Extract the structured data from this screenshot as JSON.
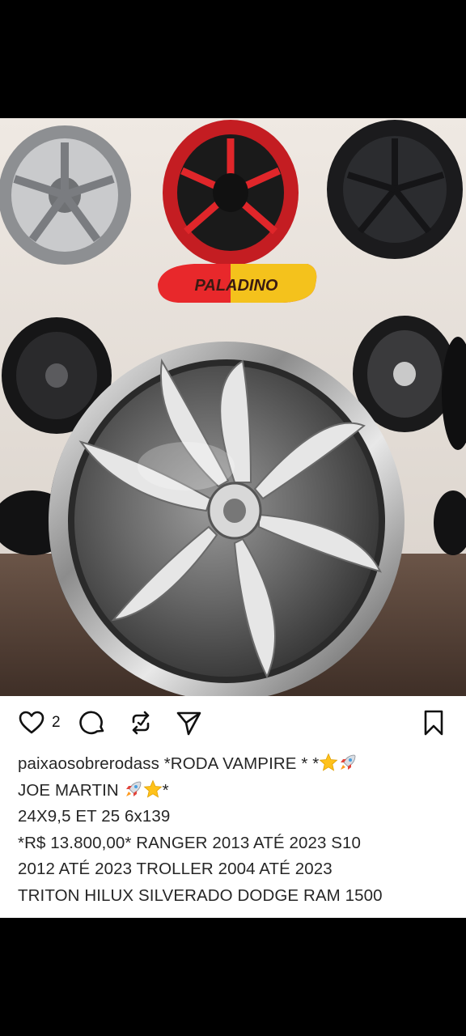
{
  "post": {
    "like_count": "2",
    "username": "paixaosobrerodass",
    "caption_lines": [
      "*RODA VAMPIRE * *",
      "JOE MARTIN ",
      "24X9,5 ET 25 6x139",
      "*R$ 13.800,00*  RANGER 2013 ATÉ 2023 S10",
      "2012 ATÉ 2023 TROLLER 2004 ATÉ 2023",
      "TRITON HILUX SILVERADO  DODGE RAM 1500"
    ],
    "caption_line2_suffix": "*"
  },
  "photo": {
    "sign_text": "PALADINO"
  },
  "icons": {
    "like": "heart-icon",
    "comment": "comment-icon",
    "repost": "repost-icon",
    "share": "send-icon",
    "save": "bookmark-icon",
    "emoji_rocket": "rocket-emoji",
    "emoji_star": "star-emoji"
  },
  "colors": {
    "background": "#000000",
    "post_bg": "#ffffff",
    "text": "#262626",
    "red_wheel": "#e0262a",
    "sign_yellow": "#f4c21c"
  }
}
